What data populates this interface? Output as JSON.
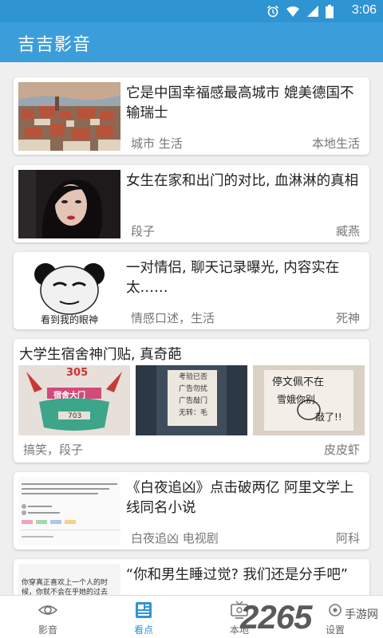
{
  "status_bar": {
    "time": "3:06",
    "icons": [
      "alarm-icon",
      "wifi-icon",
      "signal-icon",
      "battery-icon"
    ]
  },
  "app_bar": {
    "title": "吉吉影音"
  },
  "feed": [
    {
      "headline": "它是中国幸福感最高城市 媲美德国不输瑞士",
      "tags": "城市 生活",
      "source": "本地生活"
    },
    {
      "headline": "女生在家和出门的对比, 血淋淋的真相",
      "tags": "段子",
      "source": "臧燕"
    },
    {
      "headline": "一对情侣, 聊天记录曝光, 内容实在太……",
      "tags": "情感口述，生活",
      "source": "死神",
      "thumb_caption": "看到我的眼神"
    },
    {
      "headline": "大学生宿舍神门贴, 真奇葩",
      "tags": "搞笑，段子",
      "source": "皮皮虾",
      "pics": [
        {
          "top": "305",
          "mid": "宿舍大门",
          "low": "703"
        },
        {
          "lines": [
            "考验已否",
            "广告勿扰",
            "广告敲门",
            "无转：毛"
          ]
        },
        {
          "lines": [
            "停文佩不在",
            "雪娥你别",
            "敲了!!"
          ]
        }
      ]
    },
    {
      "headline": "《白夜追凶》点击破两亿 阿里文学上线同名小说",
      "tags": "白夜追凶 电视剧",
      "source": "阿科"
    },
    {
      "headline": "“你和男生睡过觉? 我们还是分手吧”",
      "thumb_text": "你穿真正喜欢上一个人的时候，你就不会在乎她的过去"
    }
  ],
  "tabs": [
    {
      "label": "影音",
      "icon": "eye-icon",
      "active": false
    },
    {
      "label": "看点",
      "icon": "newspaper-icon",
      "active": true
    },
    {
      "label": "本地",
      "icon": "tv-icon",
      "active": false
    },
    {
      "label": "设置",
      "icon": "settings-icon",
      "active": false
    }
  ],
  "watermark": {
    "number": "2265",
    "sub": "手游网"
  },
  "colors": {
    "primary": "#3b9edb",
    "status": "#2f94d2",
    "background": "#efefef",
    "text": "#222222",
    "meta": "#777777"
  }
}
